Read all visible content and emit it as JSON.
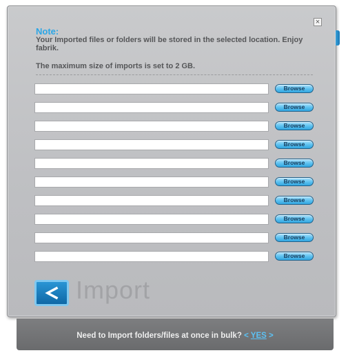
{
  "dialog": {
    "close_glyph": "×",
    "note_title": "Note:",
    "note_text": "Your Imported files or folders will be stored in the selected location. Enjoy fabrik.",
    "max_size_text": "The maximum size of imports is set to 2 GB.",
    "file_rows": [
      {
        "value": "",
        "browse_label": "Browse"
      },
      {
        "value": "",
        "browse_label": "Browse"
      },
      {
        "value": "",
        "browse_label": "Browse"
      },
      {
        "value": "",
        "browse_label": "Browse"
      },
      {
        "value": "",
        "browse_label": "Browse"
      },
      {
        "value": "",
        "browse_label": "Browse"
      },
      {
        "value": "",
        "browse_label": "Browse"
      },
      {
        "value": "",
        "browse_label": "Browse"
      },
      {
        "value": "",
        "browse_label": "Browse"
      },
      {
        "value": "",
        "browse_label": "Browse"
      }
    ],
    "back_icon": "chevron-left-icon",
    "import_title": "Import"
  },
  "bulk": {
    "question": "Need to Import folders/files at once in bulk?",
    "link_prefix": "<",
    "link_label": "YES",
    "link_suffix": ">"
  },
  "colors": {
    "accent": "#2ba6e6",
    "panel": "#c4c5c8",
    "bulk_bar": "#747577"
  }
}
